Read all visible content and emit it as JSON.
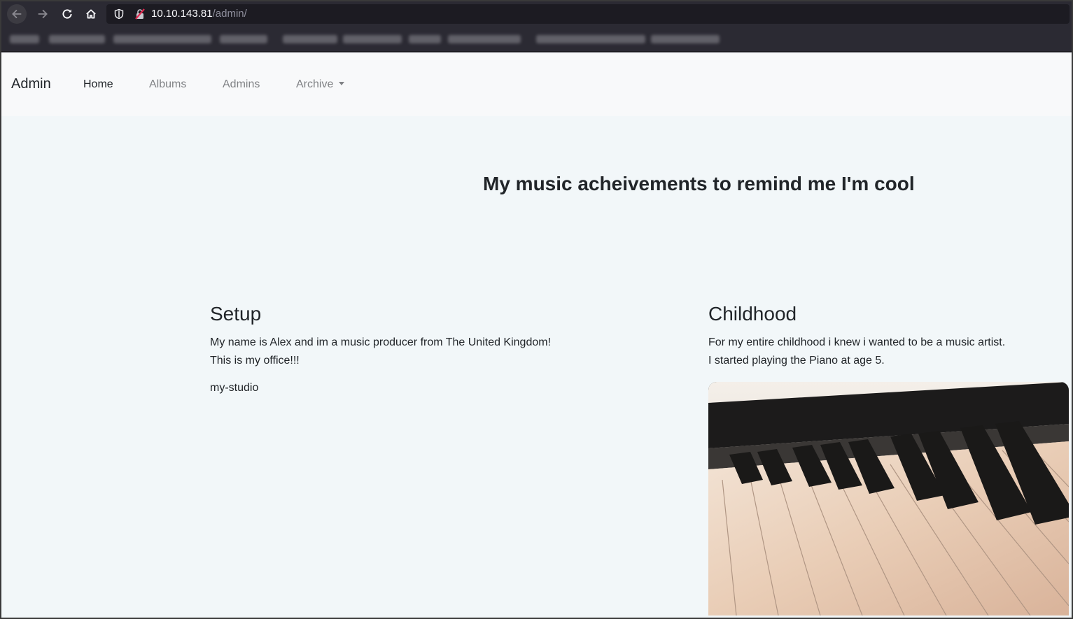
{
  "browser": {
    "url_host": "10.10.143.81",
    "url_path": "/admin/"
  },
  "navbar": {
    "brand": "Admin",
    "links": [
      {
        "label": "Home"
      },
      {
        "label": "Albums"
      },
      {
        "label": "Admins"
      },
      {
        "label": "Archive"
      }
    ]
  },
  "hero": {
    "title": "My music acheivements to remind me I'm cool"
  },
  "sections": [
    {
      "heading": "Setup",
      "lines": [
        "My name is Alex and im a music producer from The United Kingdom!",
        "This is my office!!!"
      ],
      "image_alt": "my-studio"
    },
    {
      "heading": "Childhood",
      "lines": [
        "For my entire childhood i knew i wanted to be a music artist.",
        "I started playing the Piano at age 5."
      ]
    }
  ],
  "icons": [
    "back-arrow-icon",
    "forward-arrow-icon",
    "reload-icon",
    "home-icon",
    "shield-icon",
    "insecure-lock-icon",
    "chevron-down-icon"
  ]
}
